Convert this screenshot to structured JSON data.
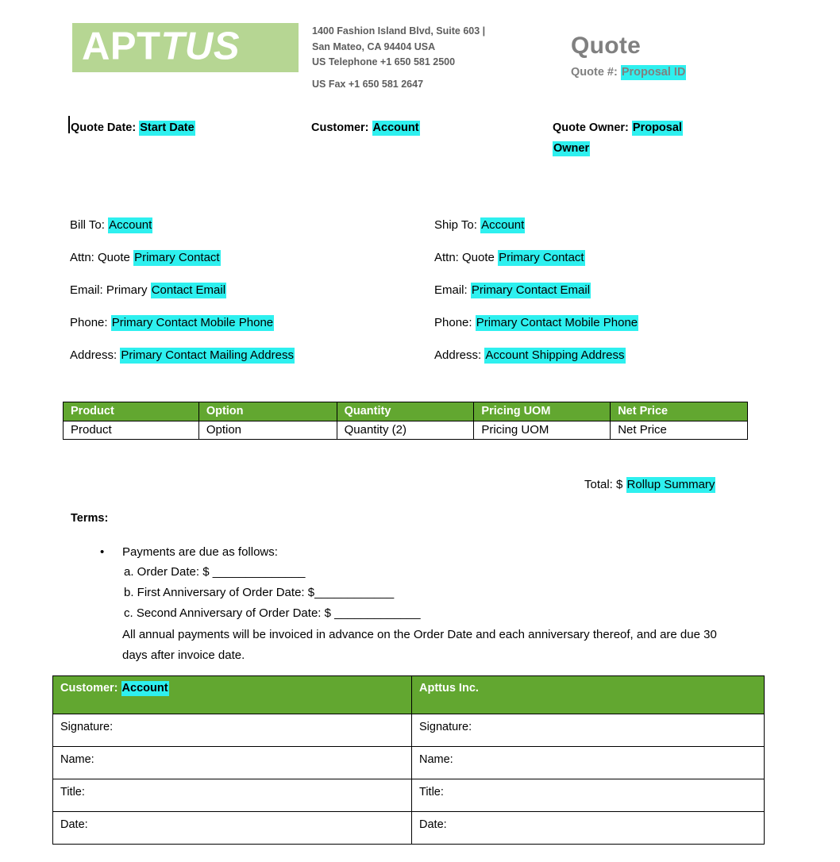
{
  "document": {
    "type": "quote-document",
    "accent_green": "#62a730",
    "logo_green": "#b6d693",
    "highlight_cyan": "#2ef0ef",
    "title_gray": "#808080"
  },
  "header": {
    "logo": {
      "text_plain": "APT",
      "text_italic": "TUS",
      "full_text": "APTTUS"
    },
    "company_address": {
      "line1": "1400 Fashion Island Blvd, Suite 603 |",
      "line2": "San Mateo, CA 94404 USA",
      "line3": "US Telephone +1 650 581 2500",
      "line4": "US Fax +1 650 581 2647"
    },
    "title": "Quote",
    "quote_number_label": "Quote #:",
    "quote_number_value": "Proposal ID"
  },
  "meta": {
    "quote_date_label": "Quote Date:",
    "quote_date_value": "Start Date",
    "customer_label": "Customer:",
    "customer_value": "Account",
    "quote_owner_label": "Quote Owner:",
    "quote_owner_value": "Proposal Owner"
  },
  "bill_to": {
    "title_label": "Bill To:",
    "title_value": "Account",
    "attn_label": "Attn: Quote",
    "attn_value": "Primary Contact",
    "email_label": "Email: Primary",
    "email_value": "Contact Email",
    "phone_label": "Phone:",
    "phone_value": "Primary Contact Mobile Phone",
    "address_label": "Address:",
    "address_value": "Primary Contact Mailing Address"
  },
  "ship_to": {
    "title_label": "Ship To:",
    "title_value": "Account",
    "attn_label": "Attn: Quote",
    "attn_value": "Primary Contact",
    "email_label": "Email:",
    "email_value": "Primary Contact Email",
    "phone_label": "Phone:",
    "phone_value": "Primary Contact Mobile Phone",
    "address_label": "Address:",
    "address_value": "Account Shipping Address"
  },
  "product_table": {
    "headers": [
      "Product",
      "Option",
      "Quantity",
      "Pricing UOM",
      "Net Price"
    ],
    "rows": [
      [
        "Product",
        "Option",
        "Quantity (2)",
        "Pricing UOM",
        "Net Price"
      ]
    ]
  },
  "total": {
    "label": "Total: $",
    "value": "Rollup Summary"
  },
  "terms": {
    "heading": "Terms:",
    "bullet_symbol": "•",
    "bullet_text": "Payments are due as follows:",
    "sub_items": [
      "a. Order Date: $ ______________",
      "b. First Anniversary of Order Date: $____________",
      "c. Second Anniversary of Order Date: $ _____________"
    ],
    "paragraph": "All annual payments will be invoiced in advance on the Order Date and each anniversary thereof, and are due 30 days after invoice date."
  },
  "signature_table": {
    "header_left_label": "Customer:",
    "header_left_value": "Account",
    "header_right": "Apttus Inc.",
    "rows": [
      {
        "left": "Signature:",
        "right": "Signature:"
      },
      {
        "left": "Name:",
        "right": "Name:"
      },
      {
        "left": "Title:",
        "right": "Title:"
      },
      {
        "left": "Date:",
        "right": "Date:"
      }
    ]
  }
}
